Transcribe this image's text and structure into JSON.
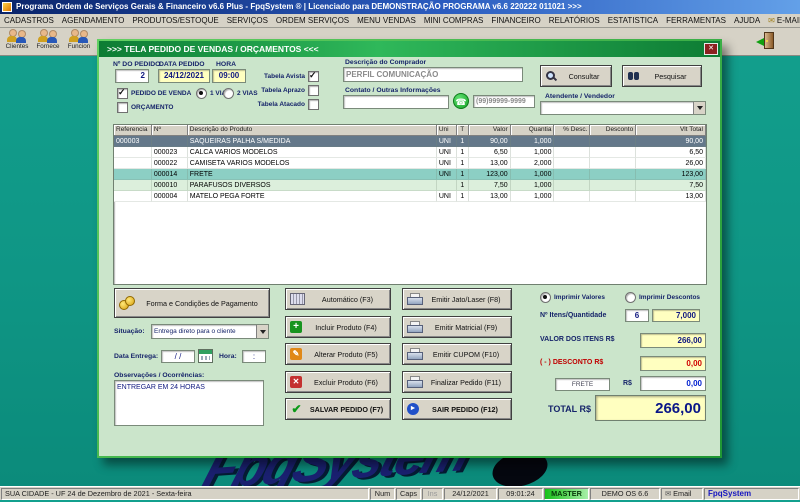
{
  "icons": {
    "email": "✉",
    "phone": "☎",
    "plus": "+",
    "pencil": "✎",
    "cross": "✕",
    "check": "✔",
    "exit_arrow": "►",
    "close": "✕"
  },
  "desktop": {
    "watermark": "FpqSystem"
  },
  "titlebar": {
    "title": "Programa Ordem de Serviços Gerais & Financeiro v6.6 Plus - FpqSystem ® | Licenciado para  DEMONSTRAÇÃO PROGRAMA v6.6 220222 011021 >>>"
  },
  "menu": {
    "items": [
      "CADASTROS",
      "AGENDAMENTO",
      "PRODUTOS/ESTOQUE",
      "SERVIÇOS",
      "ORDEM SERVIÇOS",
      "MENU VENDAS",
      "MINI COMPRAS",
      "FINANCEIRO",
      "RELATÓRIOS",
      "ESTATISTICA",
      "FERRAMENTAS",
      "AJUDA",
      "E-MAIL"
    ]
  },
  "toolbar": {
    "items": [
      "Clientes",
      "Fornece",
      "Funcion"
    ]
  },
  "window": {
    "title": ">>>  TELA PEDIDO DE VENDAS / ORÇAMENTOS  <<<",
    "checks": {
      "pedido_venda": true,
      "orcamento": false,
      "via1": true,
      "via2": false,
      "avista": true,
      "aprazo": false,
      "atacado": false,
      "imprimir_valores": true,
      "imprimir_descontos": false
    },
    "header": {
      "num_label": "Nº DO PEDIDO",
      "num_value": "2",
      "date_label": "DATA PEDIDO",
      "date_value": "24/12/2021",
      "time_label": "HORA",
      "time_value": "09:00",
      "pedido_venda": "PEDIDO DE VENDA",
      "orcamento": "ORÇAMENTO",
      "via1": "1 VIA",
      "via2": "2 VIAS",
      "tabela_avista": "Tabela Avista",
      "tabela_aprazo": "Tabela Aprazo",
      "tabela_atacado": "Tabela Atacado",
      "comprador_label": "Descrição do Comprador",
      "comprador_value": "PERFIL COMUNICAÇÃO",
      "contato_label": "Contato / Outras Informações",
      "contato_value": "",
      "phone_mask": "(99)99999-9999",
      "consultar": "Consultar",
      "pesquisar": "Pesquisar",
      "atendente_label": "Atendente / Vendedor",
      "atendente_value": ""
    },
    "table": {
      "columns": [
        "Referencia",
        "Nº",
        "Descrição do Produto",
        "Uni",
        "T",
        "Valor",
        "Quantia",
        "% Desc.",
        "Desconto",
        "Vlt Total"
      ],
      "rows": [
        {
          "selected": true,
          "cells": [
            "000003",
            "",
            "SAQUEIRAS PALHA S/MEDIDA",
            "UNI",
            "1",
            "90,00",
            "1,000",
            "",
            "",
            "90,00"
          ]
        },
        {
          "selected": false,
          "cells": [
            "",
            "000023",
            "CALCA VARIOS MODELOS",
            "UNI",
            "1",
            "6,50",
            "1,000",
            "",
            "",
            "6,50"
          ]
        },
        {
          "selected": false,
          "cells": [
            "",
            "000022",
            "CAMISETA VARIOS MODELOS",
            "UNI",
            "1",
            "13,00",
            "2,000",
            "",
            "",
            "26,00"
          ]
        },
        {
          "selected": false,
          "cells": [
            "",
            "000014",
            "FRETE",
            "UNI",
            "1",
            "123,00",
            "1,000",
            "",
            "",
            "123,00"
          ]
        },
        {
          "selected": false,
          "cells": [
            "",
            "000010",
            "PARAFUSOS DIVERSOS",
            "",
            "1",
            "7,50",
            "1,000",
            "",
            "",
            "7,50"
          ]
        },
        {
          "selected": false,
          "cells": [
            "",
            "000004",
            "MATELO PEGA FORTE",
            "UNI",
            "1",
            "13,00",
            "1,000",
            "",
            "",
            "13,00"
          ]
        }
      ]
    },
    "left_panel": {
      "payment_button": "Forma e Condições de Pagamento",
      "situacao_label": "Situação:",
      "situacao_value": "Entrega direto para o cliente",
      "entrega_label": "Data Entrega:",
      "entrega_value": "/ /",
      "hora_label": "Hora:",
      "hora_value": ":",
      "obs_label": "Observações / Ocorrências:",
      "obs_value": "ENTREGAR EM 24 HORAS"
    },
    "actions": {
      "automatico": "Automático  (F3)",
      "incluir": "Incluir Produto  (F4)",
      "alterar": "Alterar Produto  (F5)",
      "excluir": "Excluir Produto  (F6)",
      "salvar": "SALVAR PEDIDO (F7)",
      "jato": "Emitir Jato/Laser (F8)",
      "matricial": "Emitir Matricial  (F9)",
      "cupom": "Emitir CUPOM  (F10)",
      "finalizar": "Finalizar Pedido  (F11)",
      "sair": "SAIR  PEDIDO (F12)"
    },
    "summary": {
      "imprimir_valores": "Imprimir Valores",
      "imprimir_descontos": "Imprimir Descontos",
      "itens_label": "Nº Itens/Quantidade",
      "itens_value": "6",
      "quantidade_value": "7,000",
      "valor_itens_label": "VALOR DOS ITENS R$",
      "valor_itens_value": "266,00",
      "desconto_label": "( - ) DESCONTO R$",
      "desconto_value": "0,00",
      "frete_label": "FRETE",
      "frete_currency": "R$",
      "frete_value": "0,00",
      "total_label": "TOTAL R$",
      "total_value": "266,00"
    }
  },
  "statusbar": {
    "location": "SUA CIDADE - UF 24 de Dezembro de 2021  - Sexta-feira",
    "num": "Num",
    "caps": "Caps",
    "ins": "Ins",
    "date": "24/12/2021",
    "time": "09:01:24",
    "user": "MASTER",
    "version": "DEMO OS 6.6",
    "email": "Email",
    "brand": "FpqSystem"
  }
}
